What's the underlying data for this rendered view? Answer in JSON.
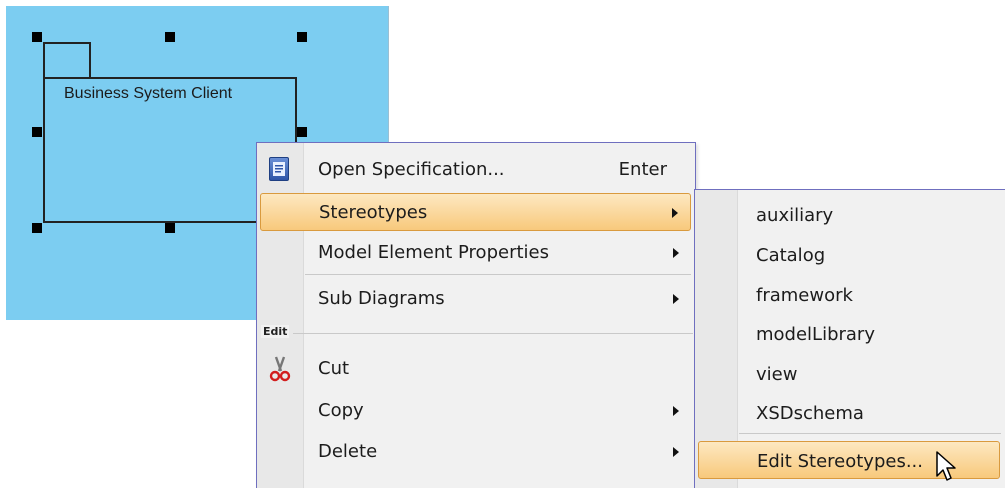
{
  "diagram": {
    "package_name": "Business System Client"
  },
  "context_menu": {
    "items": [
      {
        "label": "Open Specification...",
        "shortcut": "Enter",
        "icon": "specification-icon"
      },
      {
        "label": "Stereotypes",
        "has_submenu": true,
        "highlighted": true
      },
      {
        "label": "Model Element Properties",
        "has_submenu": true
      },
      {
        "label": "Sub Diagrams",
        "has_submenu": true
      },
      {
        "label": "Cut",
        "icon": "scissors-icon"
      },
      {
        "label": "Copy",
        "has_submenu": true
      },
      {
        "label": "Delete",
        "has_submenu": true
      }
    ],
    "group_edit_label": "Edit"
  },
  "stereotypes_submenu": {
    "items": [
      {
        "label": "auxiliary"
      },
      {
        "label": "Catalog"
      },
      {
        "label": "framework"
      },
      {
        "label": "modelLibrary"
      },
      {
        "label": "view"
      },
      {
        "label": "XSDschema"
      },
      {
        "label": "Edit Stereotypes...",
        "highlighted": true
      }
    ]
  },
  "colors": {
    "selection_background": "#7ccdf1",
    "menu_background": "#f1f1f1",
    "menu_border": "#6f6fbf",
    "highlight_top": "#fde8c1",
    "highlight_bottom": "#f8c97c",
    "highlight_border": "#d99a3e"
  }
}
